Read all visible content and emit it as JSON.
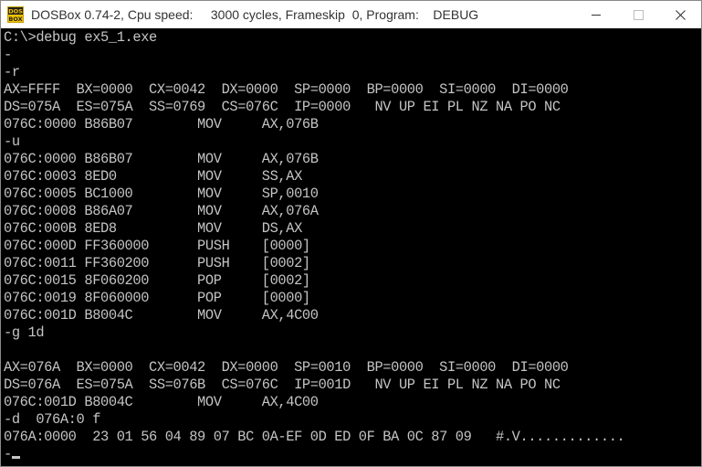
{
  "window": {
    "title": "DOSBox 0.74-2, Cpu speed:     3000 cycles, Frameskip  0, Program:    DEBUG",
    "icon": "dosbox-icon",
    "icon_text_top": "DOS",
    "icon_text_bottom": "BOX"
  },
  "terminal": {
    "lines": [
      "C:\\>debug ex5_1.exe",
      "-",
      "-r",
      "AX=FFFF  BX=0000  CX=0042  DX=0000  SP=0000  BP=0000  SI=0000  DI=0000",
      "DS=075A  ES=075A  SS=0769  CS=076C  IP=0000   NV UP EI PL NZ NA PO NC",
      "076C:0000 B86B07        MOV     AX,076B",
      "-u",
      "076C:0000 B86B07        MOV     AX,076B",
      "076C:0003 8ED0          MOV     SS,AX",
      "076C:0005 BC1000        MOV     SP,0010",
      "076C:0008 B86A07        MOV     AX,076A",
      "076C:000B 8ED8          MOV     DS,AX",
      "076C:000D FF360000      PUSH    [0000]",
      "076C:0011 FF360200      PUSH    [0002]",
      "076C:0015 8F060200      POP     [0002]",
      "076C:0019 8F060000      POP     [0000]",
      "076C:001D B8004C        MOV     AX,4C00",
      "-g 1d",
      "",
      "AX=076A  BX=0000  CX=0042  DX=0000  SP=0010  BP=0000  SI=0000  DI=0000",
      "DS=076A  ES=075A  SS=076B  CS=076C  IP=001D   NV UP EI PL NZ NA PO NC",
      "076C:001D B8004C        MOV     AX,4C00",
      "-d  076A:0 f",
      "076A:0000  23 01 56 04 89 07 BC 0A-EF 0D ED 0F BA 0C 87 09   #.V.............",
      "-"
    ]
  },
  "colors": {
    "terminal_bg": "#000000",
    "terminal_fg": "#c4c4c4",
    "titlebar_bg": "#ffffff"
  }
}
